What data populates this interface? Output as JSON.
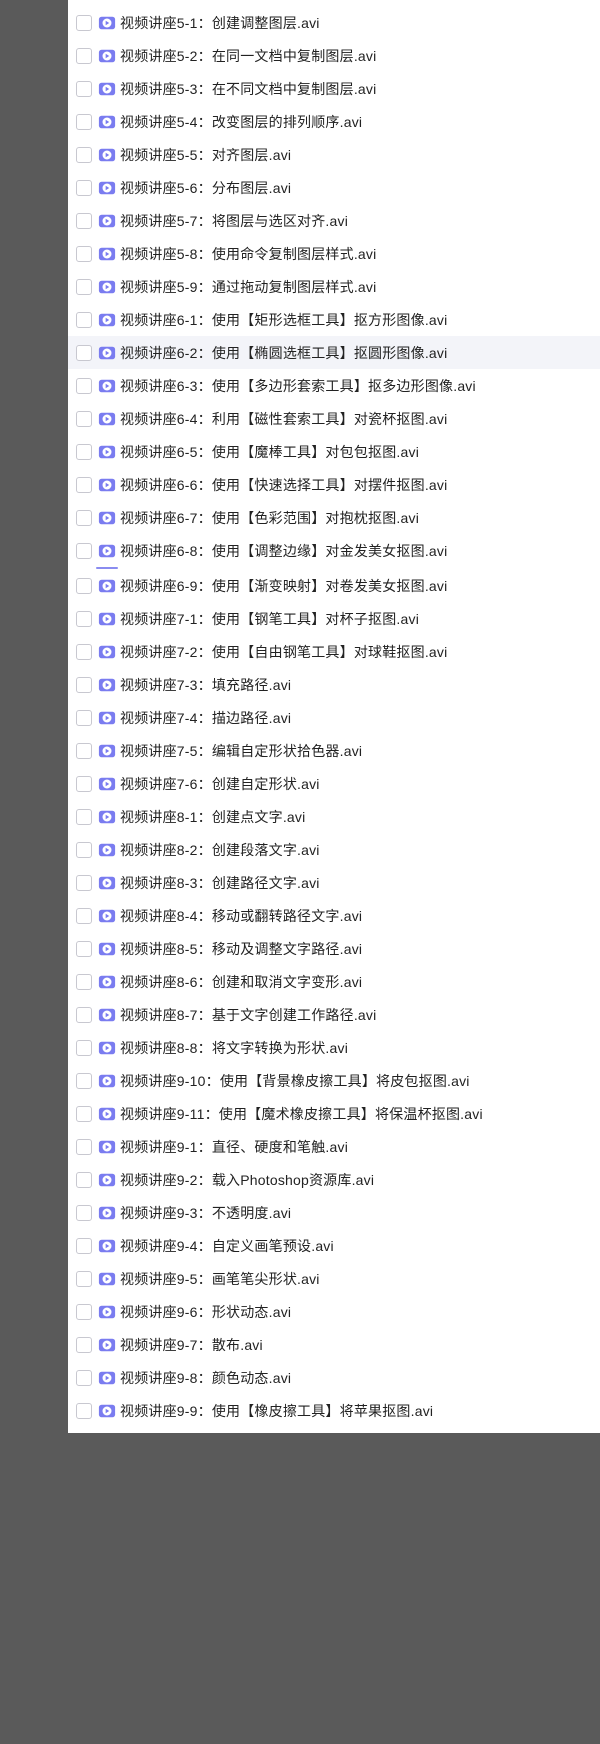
{
  "files_group1": [
    {
      "name": "视频讲座5-1：创建调整图层.avi"
    },
    {
      "name": "视频讲座5-2：在同一文档中复制图层.avi"
    },
    {
      "name": "视频讲座5-3：在不同文档中复制图层.avi"
    },
    {
      "name": "视频讲座5-4：改变图层的排列顺序.avi"
    },
    {
      "name": "视频讲座5-5：对齐图层.avi"
    },
    {
      "name": "视频讲座5-6：分布图层.avi"
    },
    {
      "name": "视频讲座5-7：将图层与选区对齐.avi"
    },
    {
      "name": "视频讲座5-8：使用命令复制图层样式.avi"
    },
    {
      "name": "视频讲座5-9：通过拖动复制图层样式.avi"
    },
    {
      "name": "视频讲座6-1：使用【矩形选框工具】抠方形图像.avi"
    },
    {
      "name": "视频讲座6-2：使用【椭圆选框工具】抠圆形图像.avi",
      "hovered": true
    },
    {
      "name": "视频讲座6-3：使用【多边形套索工具】抠多边形图像.avi"
    },
    {
      "name": "视频讲座6-4：利用【磁性套索工具】对瓷杯抠图.avi"
    },
    {
      "name": "视频讲座6-5：使用【魔棒工具】对包包抠图.avi"
    },
    {
      "name": "视频讲座6-6：使用【快速选择工具】对摆件抠图.avi"
    },
    {
      "name": "视频讲座6-7：使用【色彩范围】对抱枕抠图.avi"
    },
    {
      "name": "视频讲座6-8：使用【调整边缘】对金发美女抠图.avi"
    }
  ],
  "files_group2": [
    {
      "name": "视频讲座6-9：使用【渐变映射】对卷发美女抠图.avi"
    },
    {
      "name": "视频讲座7-1：使用【钢笔工具】对杯子抠图.avi"
    },
    {
      "name": "视频讲座7-2：使用【自由钢笔工具】对球鞋抠图.avi"
    },
    {
      "name": "视频讲座7-3：填充路径.avi"
    },
    {
      "name": "视频讲座7-4：描边路径.avi"
    },
    {
      "name": "视频讲座7-5：编辑自定形状拾色器.avi"
    },
    {
      "name": "视频讲座7-6：创建自定形状.avi"
    },
    {
      "name": "视频讲座8-1：创建点文字.avi"
    },
    {
      "name": "视频讲座8-2：创建段落文字.avi"
    },
    {
      "name": "视频讲座8-3：创建路径文字.avi"
    },
    {
      "name": "视频讲座8-4：移动或翻转路径文字.avi"
    },
    {
      "name": "视频讲座8-5：移动及调整文字路径.avi"
    },
    {
      "name": "视频讲座8-6：创建和取消文字变形.avi"
    },
    {
      "name": "视频讲座8-7：基于文字创建工作路径.avi"
    },
    {
      "name": "视频讲座8-8：将文字转换为形状.avi"
    },
    {
      "name": "视频讲座9-10：使用【背景橡皮擦工具】将皮包抠图.avi"
    },
    {
      "name": "视频讲座9-11：使用【魔术橡皮擦工具】将保温杯抠图.avi"
    },
    {
      "name": "视频讲座9-1：直径、硬度和笔触.avi"
    },
    {
      "name": "视频讲座9-2：载入Photoshop资源库.avi"
    },
    {
      "name": "视频讲座9-3：不透明度.avi"
    },
    {
      "name": "视频讲座9-4：自定义画笔预设.avi"
    },
    {
      "name": "视频讲座9-5：画笔笔尖形状.avi"
    },
    {
      "name": "视频讲座9-6：形状动态.avi"
    },
    {
      "name": "视频讲座9-7：散布.avi"
    },
    {
      "name": "视频讲座9-8：颜色动态.avi"
    },
    {
      "name": "视频讲座9-9：使用【橡皮擦工具】将苹果抠图.avi"
    }
  ]
}
